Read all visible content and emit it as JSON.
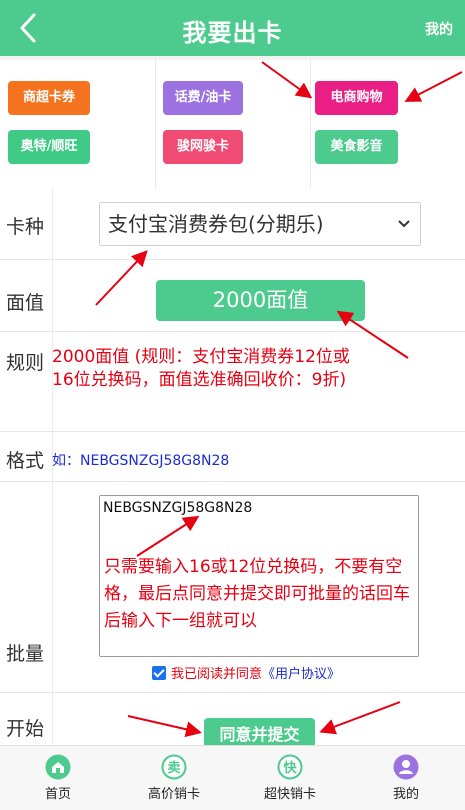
{
  "header": {
    "title": "我要出卡",
    "mine_link": "我的"
  },
  "categories": [
    {
      "label": "商超卡券",
      "color": "#f5731f"
    },
    {
      "label": "话费/油卡",
      "color": "#9b72e0"
    },
    {
      "label": "电商购物",
      "color": "#ea1f85"
    },
    {
      "label": "奥特/顺旺",
      "color": "#3fcb86"
    },
    {
      "label": "骏网骏卡",
      "color": "#ef4b73"
    },
    {
      "label": "美食影音",
      "color": "#4dcb8e"
    }
  ],
  "form": {
    "card_type": {
      "label": "卡种",
      "selected": "支付宝消费券包(分期乐)"
    },
    "face_value": {
      "label": "面值",
      "button": "2000面值"
    },
    "rule": {
      "label": "规则",
      "text": "2000面值 (规则：支付宝消费券12位或16位兑换码，面值选准确回收价：9折)"
    },
    "format": {
      "label": "格式",
      "text": "如：NEBGSNZGJ58G8N28"
    },
    "batch": {
      "label": "批量",
      "value": "NEBGSNZGJ58G8N28",
      "note": "只需要输入16或12位兑换码，不要有空格，最后点同意并提交即可批量的话回车后输入下一组就可以",
      "agree_prefix": "我已阅读并同意",
      "agreement_link": "《用户协议》"
    },
    "start": {
      "label": "开始",
      "submit": "同意并提交"
    }
  },
  "tabbar": [
    {
      "label": "首页",
      "icon": "home-icon",
      "color": "#4dcb8e"
    },
    {
      "label": "高价销卡",
      "icon": "sell-icon",
      "color": "#4dcb8e"
    },
    {
      "label": "超快销卡",
      "icon": "fast-icon",
      "color": "#4dcb8e"
    },
    {
      "label": "我的",
      "icon": "user-icon",
      "color": "#9b72e0"
    }
  ],
  "colors": {
    "brand": "#4dcb8e",
    "annotation": "#e60012",
    "link": "#1d2ccf"
  }
}
